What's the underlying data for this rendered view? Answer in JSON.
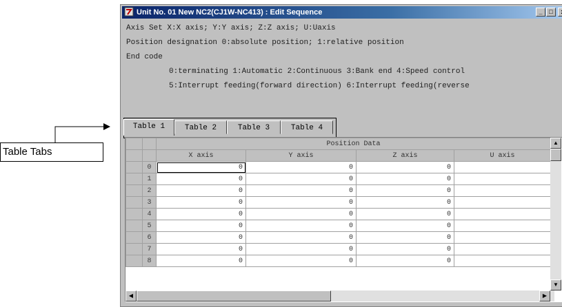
{
  "window": {
    "title": "Unit No. 01 New NC2(CJ1W-NC413) : Edit Sequence",
    "minimize_glyph": "_",
    "maximize_glyph": "□",
    "close_glyph": "x"
  },
  "info": {
    "axis_set": "Axis Set X:X axis; Y:Y axis; Z:Z axis; U:Uaxis",
    "position_designation": "Position designation 0:absolute position; 1:relative position",
    "end_code_label": "End code",
    "end_code_line1": "0:terminating 1:Automatic 2:Continuous 3:Bank end 4:Speed control",
    "end_code_line2": "5:Interrupt feeding(forward direction) 6:Interrupt feeding(reverse"
  },
  "tabs": [
    "Table 1",
    "Table 2",
    "Table 3",
    "Table 4"
  ],
  "active_tab": 0,
  "grid": {
    "group_header": "Position Data",
    "columns": [
      "X axis",
      "Y axis",
      "Z axis",
      "U axis"
    ],
    "rows": [
      {
        "index": "0",
        "values": [
          "0",
          "0",
          "0",
          ""
        ]
      },
      {
        "index": "1",
        "values": [
          "0",
          "0",
          "0",
          ""
        ]
      },
      {
        "index": "2",
        "values": [
          "0",
          "0",
          "0",
          ""
        ]
      },
      {
        "index": "3",
        "values": [
          "0",
          "0",
          "0",
          ""
        ]
      },
      {
        "index": "4",
        "values": [
          "0",
          "0",
          "0",
          ""
        ]
      },
      {
        "index": "5",
        "values": [
          "0",
          "0",
          "0",
          ""
        ]
      },
      {
        "index": "6",
        "values": [
          "0",
          "0",
          "0",
          ""
        ]
      },
      {
        "index": "7",
        "values": [
          "0",
          "0",
          "0",
          ""
        ]
      },
      {
        "index": "8",
        "values": [
          "0",
          "0",
          "0",
          ""
        ]
      }
    ]
  },
  "callout": {
    "label": "Table Tabs"
  },
  "colors": {
    "title_bar": "#0a246a",
    "window_face": "#c0c0c0"
  },
  "icons": {
    "app": "sequence-window-icon",
    "scroll_up": "arrow-up-icon",
    "scroll_down": "arrow-down-icon",
    "scroll_left": "arrow-left-icon",
    "scroll_right": "arrow-right-icon"
  }
}
